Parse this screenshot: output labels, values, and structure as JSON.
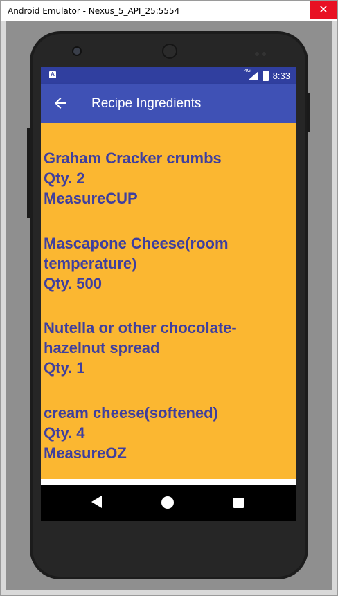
{
  "window": {
    "title": "Android Emulator - Nexus_5_API_25:5554",
    "close_glyph": "✕"
  },
  "statusbar": {
    "app_icon": "A",
    "network_label": "4G",
    "time": "8:33",
    "icons": [
      "app-notification-icon",
      "signal-icon",
      "battery-icon"
    ]
  },
  "appbar": {
    "title": "Recipe Ingredients",
    "back_icon": "arrow-left-icon"
  },
  "ingredients": [
    {
      "lines": [
        "Graham Cracker crumbs",
        "Qty. 2",
        "MeasureCUP"
      ]
    },
    {
      "lines": [
        "Mascapone Cheese(room",
        "temperature)",
        "Qty. 500"
      ]
    },
    {
      "lines": [
        "Nutella or other chocolate-",
        "hazelnut spread",
        "Qty. 1"
      ]
    },
    {
      "lines": [
        "cream cheese(softened)",
        "Qty. 4",
        "MeasureOZ"
      ]
    }
  ],
  "navbar": {
    "icons": [
      "nav-back-icon",
      "nav-home-icon",
      "nav-recents-icon"
    ]
  },
  "colors": {
    "statusbar": "#303f9f",
    "appbar": "#3f51b5",
    "content_background": "#fbb731",
    "ingredient_text": "#3f3f9e"
  }
}
